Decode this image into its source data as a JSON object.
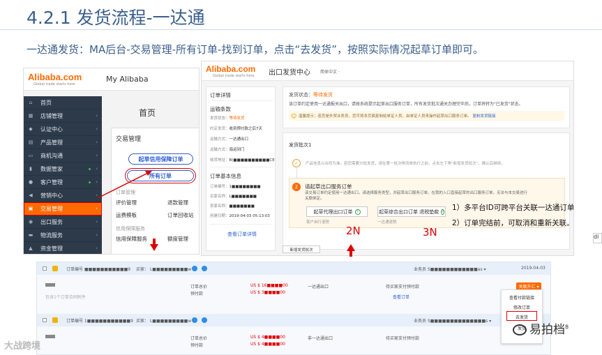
{
  "slide": {
    "title": "4.2.1 发货流程-一达通",
    "intro": "一达通发货：MA后台-交易管理-所有订单-找到订单，点击“去发货”，按照实际情况起草订单即可。"
  },
  "myalibaba": {
    "logo": "Alibaba.com",
    "logo_tagline": "Global trade starts here",
    "header_title": "My Alibaba",
    "home_label": "首页",
    "menu": [
      {
        "label": "首页",
        "icon": "home-icon",
        "arrow": ""
      },
      {
        "label": "店铺管理",
        "icon": "store-icon",
        "arrow": "›"
      },
      {
        "label": "认证中心",
        "icon": "shield-icon",
        "arrow": "›"
      },
      {
        "label": "产品管理",
        "icon": "grid-icon",
        "arrow": "›"
      },
      {
        "label": "商机沟通",
        "icon": "chat-icon",
        "arrow": "›"
      },
      {
        "label": "数据管家",
        "icon": "chart-icon",
        "arrow": "›"
      },
      {
        "label": "客户管理",
        "icon": "user-icon",
        "arrow": "›"
      },
      {
        "label": "营销中心",
        "icon": "megaphone-icon",
        "arrow": "›"
      },
      {
        "label": "交易管理",
        "icon": "doc-icon",
        "arrow": "›"
      },
      {
        "label": "出口服务",
        "icon": "globe-icon",
        "arrow": "›"
      },
      {
        "label": "物流服务",
        "icon": "truck-icon",
        "arrow": "›"
      },
      {
        "label": "资金管理",
        "icon": "bank-icon",
        "arrow": "›"
      }
    ],
    "popup": {
      "title": "交易管理",
      "btn_draft": "起草信用保障订单",
      "btn_all": "所有订单",
      "group1": "订单管理",
      "link_eval": "评价管理",
      "link_refund": "退款管理",
      "link_template": "运费模板",
      "link_recycle": "订单回收站",
      "group2": "信用保障服务",
      "link_credit_ship": "信用保障服务",
      "link_quota": "额度管理"
    }
  },
  "export_center": {
    "logo": "Alibaba.com",
    "logo_tagline": "Global trade starts here",
    "title": "出口发货中心",
    "lang": "简体中文 ·",
    "order_card": {
      "title": "订单详情",
      "shipping_terms": "运输条款",
      "rows": [
        {
          "k": "发货状态：",
          "v": "等待发货",
          "orange": true
        },
        {
          "k": "约定发货：",
          "v": "收到预付款之后7天",
          "orange": false
        },
        {
          "k": "运输方式：",
          "v": "一达通出口",
          "orange": false
        },
        {
          "k": "运输方式：",
          "v": "海运到门",
          "orange": false
        },
        {
          "k": "收货地址：",
          "v": "B(■■■■■■■■■■CE",
          "orange": false
        }
      ],
      "base_title": "订单基本信息",
      "base_rows": [
        {
          "k": "订单编号：",
          "v": "1■■■■■■■■"
        },
        {
          "k": "买家名称：",
          "v": "L■■■■■■■"
        },
        {
          "k": "卖家名称：",
          "v": "■■■■■■■"
        },
        {
          "k": "创建日期：",
          "v": "2019-04-03 05:13:03"
        }
      ],
      "view_link": "查看订单详情"
    },
    "status_card": {
      "status_label": "发货状态：",
      "status_value": "等待发货",
      "line2": "该订单约定使用一达通报关出口，请按系统提示起草出口服务订单，所有发货批次通关办理完毕后，订单将转为\"已发货\"状态。",
      "note": "温馨提示：若您是外贸业务员，您可将本页面复制给单证人员，由单证人员来操作起草出口服务订单。",
      "note_link": "复制发货链接"
    },
    "batch_card": {
      "title": "发货批次1",
      "step1_desc": "产品信息以合同为准。若您需要分批发货，请在第一批次物流单执行之前，点击左下角\"新增发货批次\"，确认后继续。",
      "step2_num": "2",
      "step2_title": "请起草出口服务订单",
      "step2_desc1": "该交易订单约定使用一达通出口，请选择服务类型，并起草出口服务订单。在我的入口直接起草的出口服务订单，无法与本交易进行",
      "step2_desc2": "关联绑定。",
      "btn_agent": "起草代理出口订单",
      "btn_combined": "起草综合出口订单",
      "btn_combined_extra": "退税垫款",
      "sub_agent": "客户自行退税",
      "sub_combined": "一达通退税"
    },
    "new_batch": "新增发货批次"
  },
  "annotations": {
    "note1": "1）多平台ID可跨平台关联一达通订单",
    "note2": "2）订单完结前，可取消和重新关联。",
    "label_2n": "2N",
    "label_3n": "3N",
    "side_tag": "di"
  },
  "orders_table": {
    "rows": [
      {
        "order_no_label": "订单编号",
        "order_no": "■■■■■■■■■■■9",
        "buyer_label": "买家：",
        "buyer": "L■■■■■■■■■w",
        "salesman_label": "业务员",
        "salesman": "S■■■■■■■■■■■■as ▾",
        "date": "2019-04-03",
        "total_label": "订单总价",
        "prepay_label": "预付款",
        "total": "US $ 16■■■■00",
        "prepay": "US $ 3■■■■00",
        "ship_type": "一达通出口",
        "status": "待买家支付预付款",
        "view_link": "查看订单",
        "hint": "包含1个订单合同附件",
        "action": "关联升汇 ▾"
      },
      {
        "order_no_label": "订单编号 1",
        "order_no": "■■■■■■■■■■■9",
        "buyer_label": "买家：",
        "buyer": "L■■■■■■■■■w",
        "salesman_label": "业务员",
        "salesman": "S■■■■■■■■■■■■■■s ▾",
        "date": "",
        "total_label": "订单总价",
        "prepay_label": "预付款",
        "total": "US $ 4■■■■00",
        "prepay": "US $ 4■■■■00",
        "ship_type": "非一达通出口",
        "status": "待买家支付预付款",
        "view_link": "",
        "hint": "",
        "action": ""
      }
    ],
    "dropdown": {
      "item1": "查看付款链接",
      "item2": "修改订单",
      "item3": "去发货",
      "item4": "发货"
    }
  },
  "watermarks": {
    "left": "大战跨境",
    "right": "易拍档",
    "right_sup": "8"
  }
}
